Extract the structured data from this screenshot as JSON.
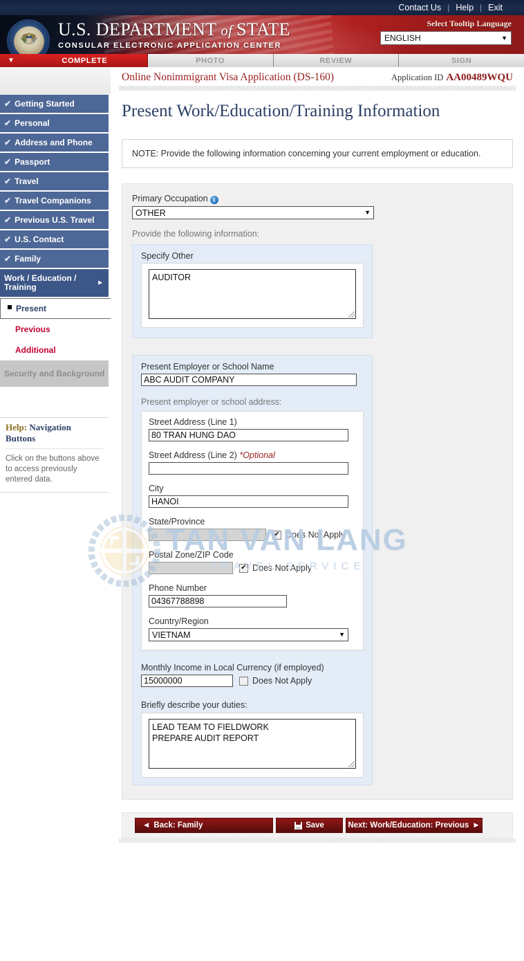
{
  "topbar": {
    "links": [
      "Contact Us",
      "Help",
      "Exit"
    ]
  },
  "banner": {
    "org_line1_prefix": "U.S. ",
    "org_line1_dept": "DEPARTMENT",
    "org_line1_of": "of",
    "org_line1_state": "STATE",
    "org_line2": "CONSULAR ELECTRONIC APPLICATION CENTER",
    "language_label": "Select Tooltip Language",
    "language_value": "ENGLISH"
  },
  "steps": [
    {
      "label": "COMPLETE",
      "state": "active"
    },
    {
      "label": "PHOTO",
      "state": "inactive"
    },
    {
      "label": "REVIEW",
      "state": "inactive"
    },
    {
      "label": "SIGN",
      "state": "inactive"
    }
  ],
  "sidebar": {
    "items": [
      {
        "label": "Getting Started",
        "complete": true
      },
      {
        "label": "Personal",
        "complete": true
      },
      {
        "label": "Address and Phone",
        "complete": true
      },
      {
        "label": "Passport",
        "complete": true
      },
      {
        "label": "Travel",
        "complete": true
      },
      {
        "label": "Travel Companions",
        "complete": true
      },
      {
        "label": "Previous U.S. Travel",
        "complete": true
      },
      {
        "label": "U.S. Contact",
        "complete": true
      },
      {
        "label": "Family",
        "complete": true
      }
    ],
    "current": {
      "label": "Work / Education / Training"
    },
    "subitems": [
      {
        "label": "Present",
        "selected": true
      },
      {
        "label": "Previous",
        "selected": false
      },
      {
        "label": "Additional",
        "selected": false
      }
    ],
    "disabled_item": {
      "label": "Security and Background"
    },
    "help": {
      "title_word": "Help:",
      "title_rest": " Navigation Buttons",
      "body": "Click on the buttons above to access previously entered data."
    }
  },
  "header": {
    "app_title": "Online Nonimmigrant Visa Application (DS-160)",
    "app_id_label": "Application ID",
    "app_id_value": "AA00489WQU",
    "page_title": "Present Work/Education/Training Information",
    "note": "NOTE: Provide the following information concerning your current employment or education."
  },
  "form": {
    "primary_occupation": {
      "label": "Primary Occupation",
      "info_icon": "info-icon",
      "value": "OTHER"
    },
    "provide_info_label": "Provide the following information:",
    "specify_other": {
      "label": "Specify Other",
      "value": "AUDITOR"
    },
    "employer_name": {
      "label": "Present Employer or School Name",
      "value": "ABC AUDIT COMPANY"
    },
    "address_group_label": "Present employer or school address:",
    "street1": {
      "label": "Street Address (Line 1)",
      "value": "80 TRAN HUNG DAO"
    },
    "street2": {
      "label": "Street Address (Line 2)",
      "optional": "*Optional",
      "value": ""
    },
    "city": {
      "label": "City",
      "value": "HANOI"
    },
    "state": {
      "label": "State/Province",
      "value": "",
      "dna_label": "Does Not Apply",
      "dna_checked": true
    },
    "postal": {
      "label": "Postal Zone/ZIP Code",
      "value": "",
      "dna_label": "Does Not Apply",
      "dna_checked": true
    },
    "phone": {
      "label": "Phone Number",
      "value": "04367788898"
    },
    "country": {
      "label": "Country/Region",
      "value": "VIETNAM"
    },
    "income": {
      "label": "Monthly Income in Local Currency (if employed)",
      "value": "15000000",
      "dna_label": "Does Not Apply",
      "dna_checked": false
    },
    "duties": {
      "label": "Briefly describe your duties:",
      "value": "LEAD TEAM TO FIELDWORK\nPREPARE AUDIT REPORT"
    }
  },
  "buttons": {
    "back": "Back: Family",
    "save": "Save",
    "save_icon": "floppy-disk-icon",
    "next": "Next: Work/Education: Previous"
  },
  "watermark": {
    "title": "TAN VAN LANG",
    "subtitle": "TRAVEL SERVICE"
  },
  "colors": {
    "brand_red": "#a81d1d",
    "nav_blue": "#4d6796",
    "nav_blue_active": "#3c5687",
    "link_red": "#c3002f",
    "title_blue": "#2b3f66"
  }
}
